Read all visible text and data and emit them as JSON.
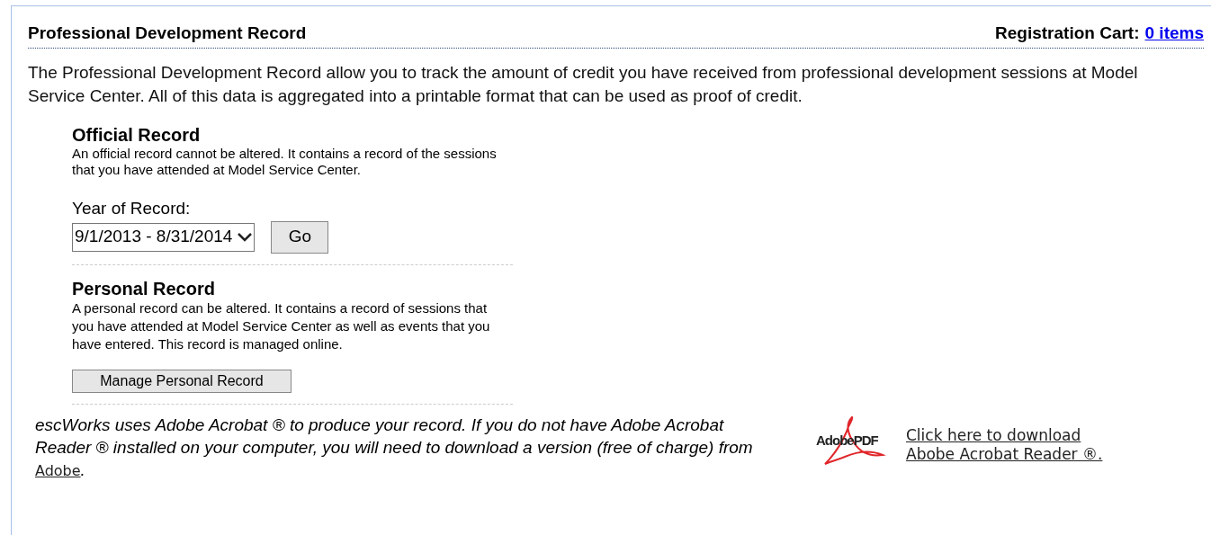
{
  "header": {
    "title": "Professional Development Record",
    "cart_label": "Registration Cart:",
    "cart_link": "0 items"
  },
  "intro": "The Professional Development Record allow you to track the amount of credit you have received from professional development sessions at Model Service Center. All of this data is aggregated into a printable format that can be used as proof of credit.",
  "official": {
    "title": "Official Record",
    "description": "An official record cannot be altered. It contains a record of the sessions that you have attended at Model Service Center.",
    "year_label": "Year of Record:",
    "year_value": "9/1/2013 - 8/31/2014",
    "go_button": "Go"
  },
  "personal": {
    "title": "Personal Record",
    "description": "A personal record can be altered. It contains a record of sessions that you have attended at Model Service Center as well as events that you have entered. This record is managed online.",
    "button": "Manage Personal Record"
  },
  "footer": {
    "note_before": "escWorks uses Adobe Acrobat ® to produce your record. If you do not have Adobe Acrobat Reader ® installed on your computer, you will need to download a version (free of charge) from ",
    "note_link": "Adobe",
    "note_after": ".",
    "logo_text_a": "Adobe",
    "logo_text_b": "PDF",
    "download_line_1": "Click here to download",
    "download_line_2": "Abobe Acrobat Reader ®."
  }
}
